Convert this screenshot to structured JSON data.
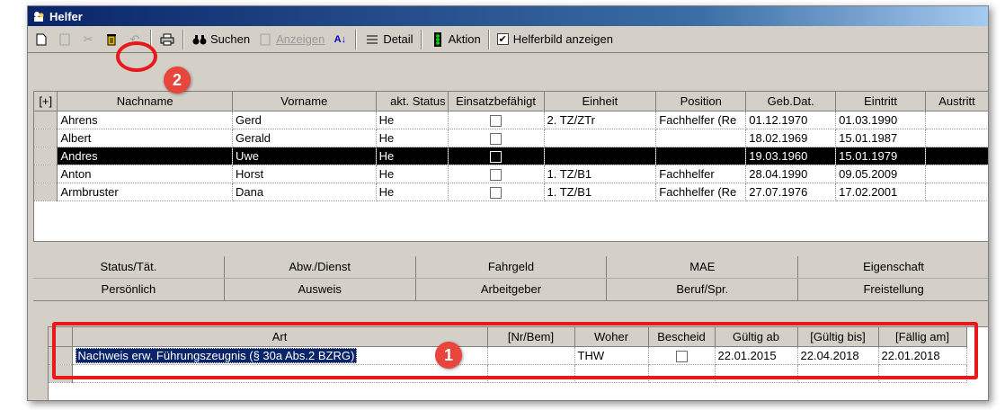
{
  "window": {
    "title": "Helfer"
  },
  "toolbar": {
    "search_label": "Suchen",
    "show_label": "Anzeigen",
    "detail_label": "Detail",
    "action_label": "Aktion",
    "show_picture_label": "Helferbild anzeigen",
    "show_picture_checked": true
  },
  "helpers_table": {
    "columns": [
      "[+]",
      "Nachname",
      "Vorname",
      "akt. Status",
      "Einsatzbefähigt",
      "Einheit",
      "Position",
      "Geb.Dat.",
      "Eintritt",
      "Austritt"
    ],
    "rows": [
      {
        "nachname": "Ahrens",
        "vorname": "Gerd",
        "status": "He",
        "einheit": "2. TZ/ZTr",
        "position": "Fachhelfer (Re",
        "geb": "01.12.1970",
        "eintritt": "01.03.1990",
        "selected": false
      },
      {
        "nachname": "Albert",
        "vorname": "Gerald",
        "status": "He",
        "einheit": "",
        "position": "",
        "geb": "18.02.1969",
        "eintritt": "15.01.1987",
        "selected": false
      },
      {
        "nachname": "Andres",
        "vorname": "Uwe",
        "status": "He",
        "einheit": "",
        "position": "",
        "geb": "19.03.1960",
        "eintritt": "15.01.1979",
        "selected": true
      },
      {
        "nachname": "Anton",
        "vorname": "Horst",
        "status": "He",
        "einheit": "1. TZ/B1",
        "position": "Fachhelfer",
        "geb": "28.04.1990",
        "eintritt": "09.05.2009",
        "selected": false
      },
      {
        "nachname": "Armbruster",
        "vorname": "Dana",
        "status": "He",
        "einheit": "1. TZ/B1",
        "position": "Fachhelfer (Re",
        "geb": "27.07.1976",
        "eintritt": "17.02.2001",
        "selected": false
      }
    ]
  },
  "tabs": {
    "row1": [
      "Status/Tät.",
      "Abw./Dienst",
      "Fahrgeld",
      "MAE",
      "Eigenschaft"
    ],
    "row2": [
      "Persönlich",
      "Ausweis",
      "Arbeitgeber",
      "Beruf/Spr.",
      "Freistellung"
    ]
  },
  "documents_table": {
    "columns": [
      "Art",
      "[Nr/Bem]",
      "Woher",
      "Bescheid",
      "Gültig ab",
      "[Gültig bis]",
      "[Fällig am]"
    ],
    "rows": [
      {
        "art": "Nachweis erw. Führungszeugnis (§ 30a Abs.2 BZRG)",
        "nr": "",
        "woher": "THW",
        "gueltig_ab": "22.01.2015",
        "gueltig_bis": "22.04.2018",
        "faellig": "22.01.2018"
      }
    ]
  },
  "annotations": {
    "badge1": "1",
    "badge2": "2",
    "color": "#e8191a"
  }
}
